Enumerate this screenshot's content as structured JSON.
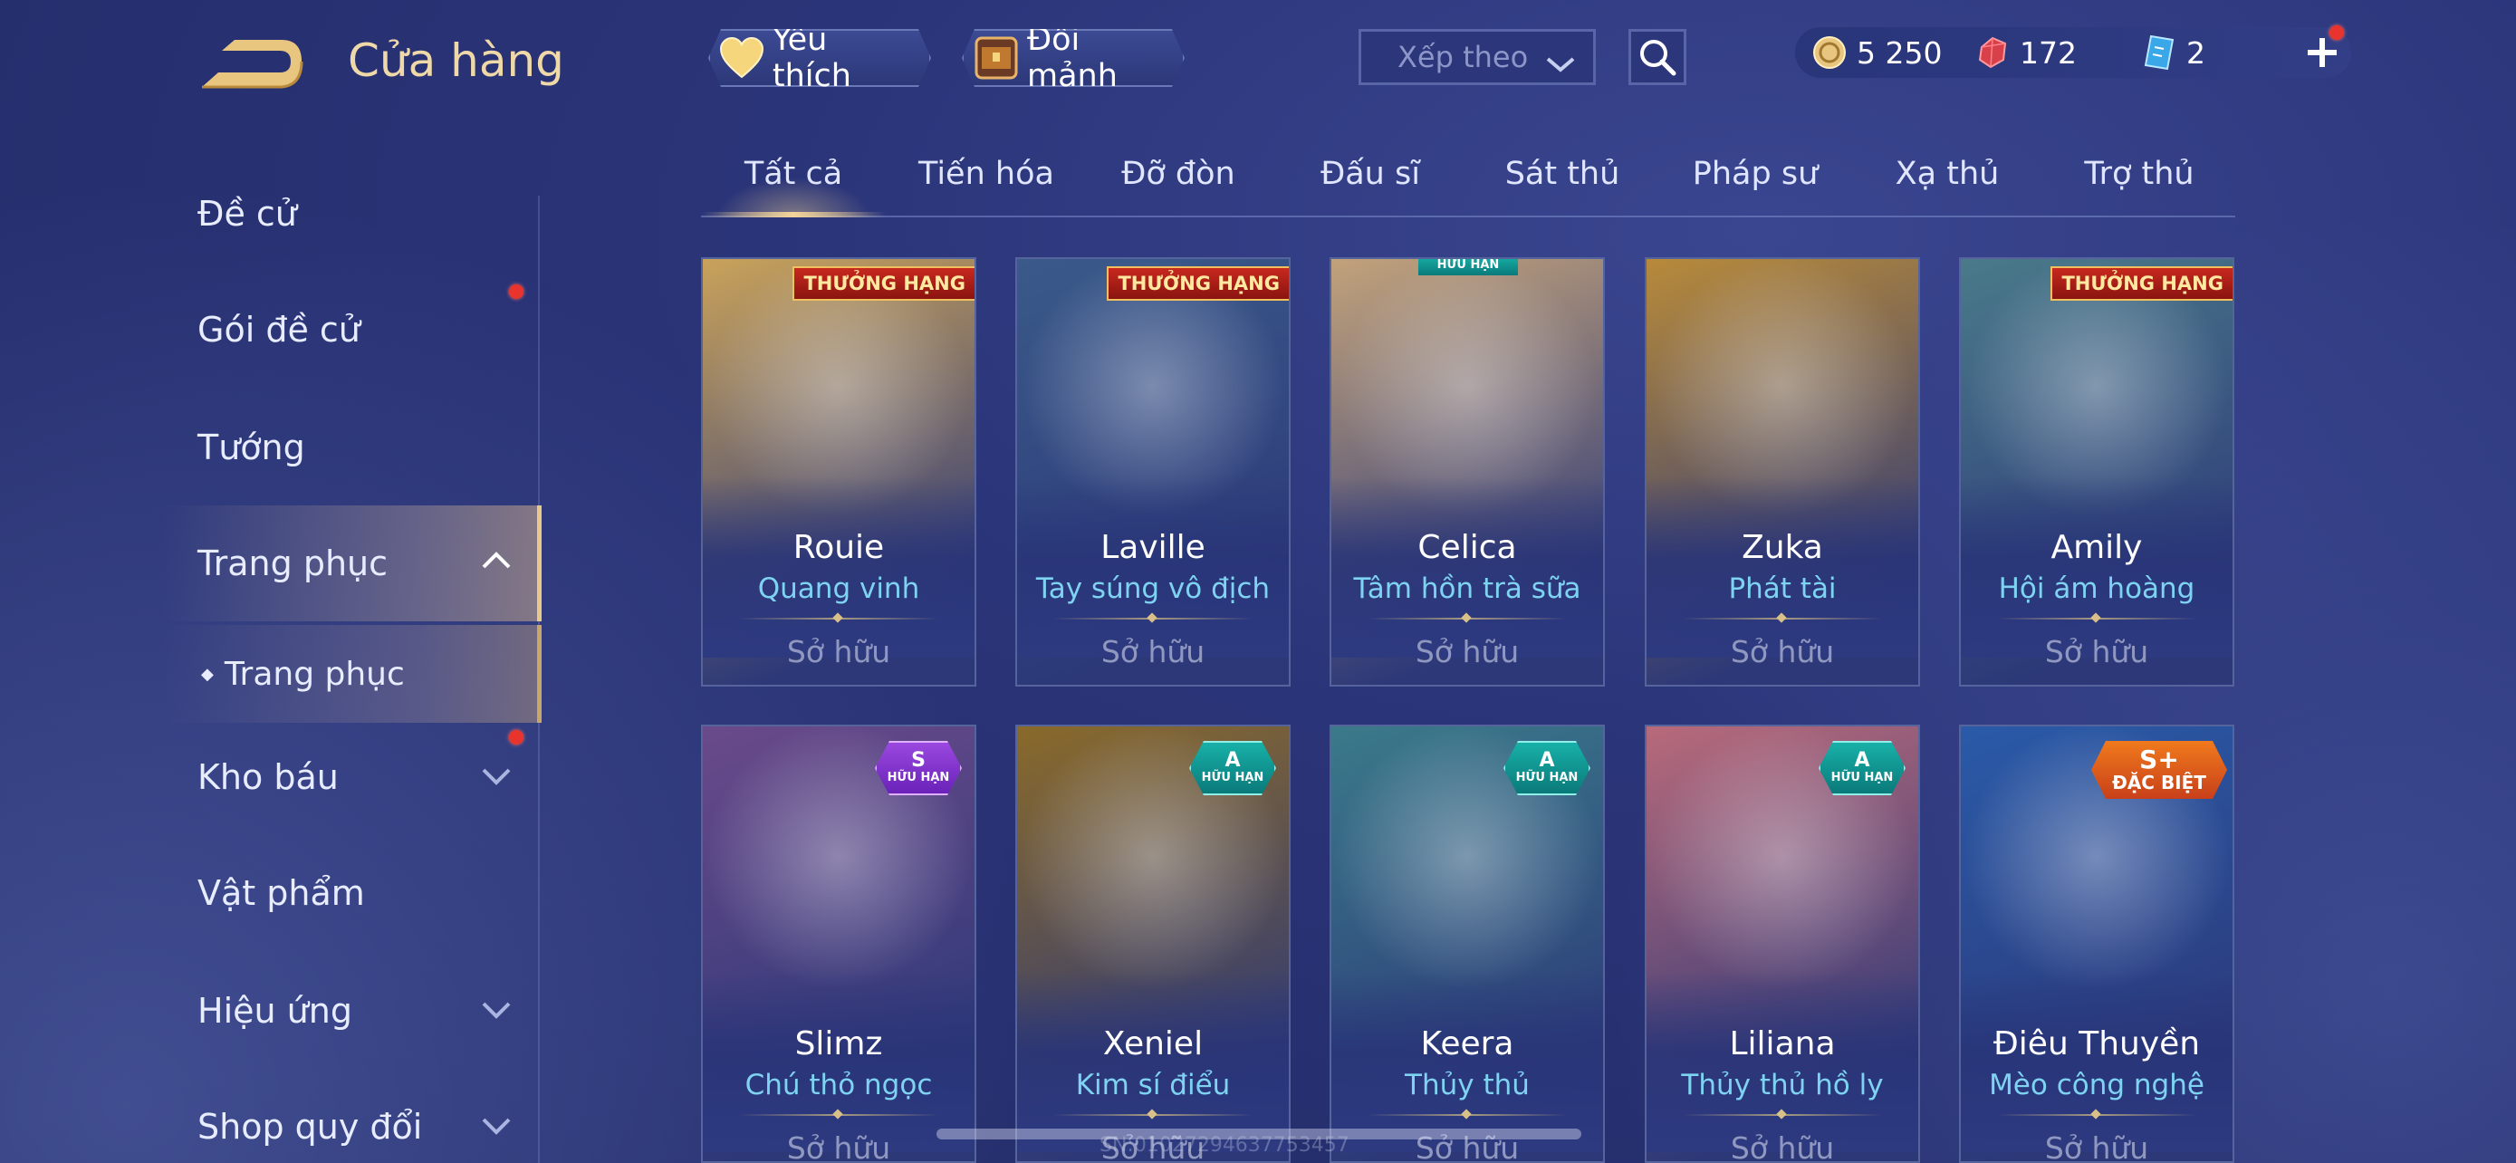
{
  "header": {
    "title": "Cửa hàng",
    "favorites_label": "Yêu thích",
    "fragments_label": "Đổi mảnh",
    "sort_placeholder": "Xếp theo"
  },
  "currency": {
    "gold": "5 250",
    "ruby": "172",
    "voucher": "2"
  },
  "sidebar": {
    "items": [
      {
        "label": "Đề cử"
      },
      {
        "label": "Gói đề cử"
      },
      {
        "label": "Tướng"
      },
      {
        "label": "Trang phục"
      },
      {
        "label": "Trang phục"
      },
      {
        "label": "Kho báu"
      },
      {
        "label": "Vật phẩm"
      },
      {
        "label": "Hiệu ứng"
      },
      {
        "label": "Shop quy đổi"
      }
    ]
  },
  "tabs": [
    {
      "label": "Tất cả"
    },
    {
      "label": "Tiến hóa"
    },
    {
      "label": "Đỡ đòn"
    },
    {
      "label": "Đấu sĩ"
    },
    {
      "label": "Sát thủ"
    },
    {
      "label": "Pháp sư"
    },
    {
      "label": "Xạ thủ"
    },
    {
      "label": "Trợ thủ"
    }
  ],
  "cards": [
    {
      "hero": "Rouie",
      "skin": "Quang vinh",
      "status": "Sở hữu",
      "badge": "THƯỞNG HẠNG",
      "color": "#c9a25a"
    },
    {
      "hero": "Laville",
      "skin": "Tay súng vô địch",
      "status": "Sở hữu",
      "badge": "THƯỞNG HẠNG",
      "color": "#3a5a8a"
    },
    {
      "hero": "Celica",
      "skin": "Tâm hồn trà sữa",
      "status": "Sở hữu",
      "badge": "HỮU HẠN",
      "color": "#c2a27a"
    },
    {
      "hero": "Zuka",
      "skin": "Phát tài",
      "status": "Sở hữu",
      "badge": "",
      "color": "#b88a3a"
    },
    {
      "hero": "Amily",
      "skin": "Hội ám hoàng",
      "status": "Sở hữu",
      "badge": "THƯỞNG HẠNG",
      "color": "#4a7a8a"
    },
    {
      "hero": "Slimz",
      "skin": "Chú thỏ ngọc",
      "status": "Sở hữu",
      "tier": "S",
      "tier_sub": "HỮU HẠN",
      "color": "#6a4a8a"
    },
    {
      "hero": "Xeniel",
      "skin": "Kim sí điểu",
      "status": "Sở hữu",
      "tier": "A",
      "tier_sub": "HỮU HẠN",
      "color": "#8a6a2a"
    },
    {
      "hero": "Keera",
      "skin": "Thủy thủ",
      "status": "Sở hữu",
      "tier": "A",
      "tier_sub": "HỮU HẠN",
      "color": "#3a7a8a"
    },
    {
      "hero": "Liliana",
      "skin": "Thủy thủ hồ ly",
      "status": "Sở hữu",
      "tier": "A",
      "tier_sub": "HỮU HẠN",
      "color": "#b86a7a"
    },
    {
      "hero": "Điêu Thuyền",
      "skin": "Mèo công nghệ",
      "status": "Sở hữu",
      "tier": "S+",
      "tier_sub": "ĐẶC BIỆT",
      "color": "#2a5aa8"
    }
  ],
  "footer": {
    "watermark": "SN:01027294637753457"
  }
}
